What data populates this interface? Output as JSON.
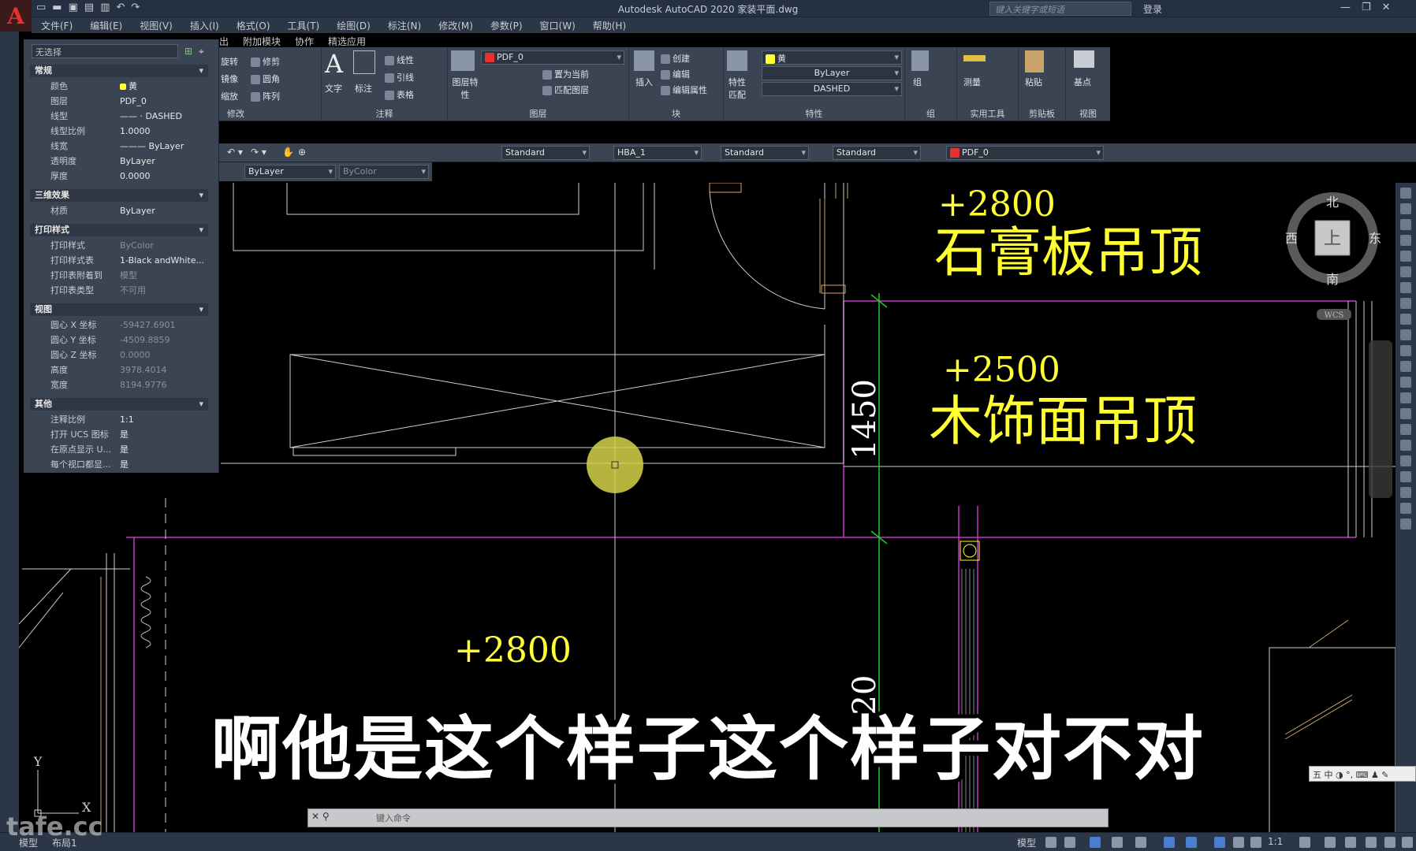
{
  "app": {
    "title": "Autodesk AutoCAD 2020    家装平面.dwg",
    "search_placeholder": "键入关键字或短语",
    "login": "登录",
    "logo": "A"
  },
  "menu": [
    "文件(F)",
    "编辑(E)",
    "视图(V)",
    "插入(I)",
    "格式(O)",
    "工具(T)",
    "绘图(D)",
    "标注(N)",
    "修改(M)",
    "参数(P)",
    "窗口(W)",
    "帮助(H)"
  ],
  "ribbon_tabs": [
    "出",
    "附加模块",
    "协作",
    "精选应用"
  ],
  "ribbon": {
    "modify": {
      "label": "修改",
      "items": [
        "旋转",
        "修剪",
        "镜像",
        "圆角",
        "缩放",
        "阵列"
      ]
    },
    "annotation": {
      "label": "注释",
      "text": "文字",
      "dim": "标注",
      "linear": "线性",
      "leader": "引线",
      "table": "表格"
    },
    "layers": {
      "label": "图层",
      "props": "图层特性",
      "current_layer": "PDF_0",
      "set_current": "置为当前",
      "match": "匹配图层"
    },
    "block": {
      "label": "块",
      "insert": "插入",
      "create": "创建",
      "edit": "编辑",
      "edit_attr": "编辑属性"
    },
    "properties": {
      "label": "特性",
      "match": "特性匹配",
      "color": "黄",
      "lineweight": "ByLayer",
      "linetype": "DASHED"
    },
    "group": {
      "label": "组",
      "group": "组"
    },
    "utilities": {
      "label": "实用工具",
      "measure": "测量"
    },
    "clipboard": {
      "label": "剪贴板",
      "paste": "粘贴"
    },
    "view": {
      "label": "视图",
      "base": "基点"
    }
  },
  "toolbar2": {
    "text_style": "Standard",
    "dim_style": "HBA_1",
    "table_style": "Standard",
    "mleader_style": "Standard",
    "layer": "PDF_0"
  },
  "toolbar3": {
    "lineweight": "ByLayer",
    "plotstyle": "ByColor"
  },
  "properties_panel": {
    "selection": "无选择",
    "sections": [
      {
        "name": "常规",
        "rows": [
          {
            "k": "颜色",
            "v": "黄"
          },
          {
            "k": "图层",
            "v": "PDF_0"
          },
          {
            "k": "线型",
            "v": "—— · DASHED"
          },
          {
            "k": "线型比例",
            "v": "1.0000"
          },
          {
            "k": "线宽",
            "v": "——— ByLayer"
          },
          {
            "k": "透明度",
            "v": "ByLayer"
          },
          {
            "k": "厚度",
            "v": "0.0000"
          }
        ]
      },
      {
        "name": "三维效果",
        "rows": [
          {
            "k": "材质",
            "v": "ByLayer"
          }
        ]
      },
      {
        "name": "打印样式",
        "rows": [
          {
            "k": "打印样式",
            "v": "ByColor",
            "dim": true
          },
          {
            "k": "打印样式表",
            "v": "1-Black andWhite..."
          },
          {
            "k": "打印表附着到",
            "v": "模型",
            "dim": true
          },
          {
            "k": "打印表类型",
            "v": "不可用",
            "dim": true
          }
        ]
      },
      {
        "name": "视图",
        "rows": [
          {
            "k": "圆心 X 坐标",
            "v": "-59427.6901",
            "dim": true
          },
          {
            "k": "圆心 Y 坐标",
            "v": "-4509.8859",
            "dim": true
          },
          {
            "k": "圆心 Z 坐标",
            "v": "0.0000",
            "dim": true
          },
          {
            "k": "高度",
            "v": "3978.4014",
            "dim": true
          },
          {
            "k": "宽度",
            "v": "8194.9776",
            "dim": true
          }
        ]
      },
      {
        "name": "其他",
        "rows": [
          {
            "k": "注释比例",
            "v": "1:1"
          },
          {
            "k": "打开 UCS 图标",
            "v": "是"
          },
          {
            "k": "在原点显示 U...",
            "v": "是"
          },
          {
            "k": "每个视口都显...",
            "v": "是"
          }
        ]
      }
    ]
  },
  "drawing": {
    "label_elev1": "+2800",
    "label_ceiling1": "石膏板吊顶",
    "label_elev2": "+2500",
    "label_ceiling2": "木饰面吊顶",
    "label_elev3": "+2800",
    "dim1": "1450",
    "dim2": "20",
    "compass_n": "北",
    "compass_s": "南",
    "compass_w": "西",
    "compass_e": "东",
    "compass_center": "上",
    "wcs": "WCS",
    "ucs_x": "X",
    "ucs_y": "Y"
  },
  "command": {
    "placeholder": "键入命令"
  },
  "status": {
    "model_tab": "模型",
    "layout_tab": "布局1",
    "scale": "1:1"
  },
  "subtitle": "啊他是这个样子这个样子对不对",
  "watermark": "tafe.cc",
  "ime": "五 中 ◑ °, ⌨ ♟ ✎",
  "colors": {
    "yellow": "#ffff33",
    "magenta": "#c837c8",
    "green": "#22cc22",
    "accent": "#3b4453"
  }
}
